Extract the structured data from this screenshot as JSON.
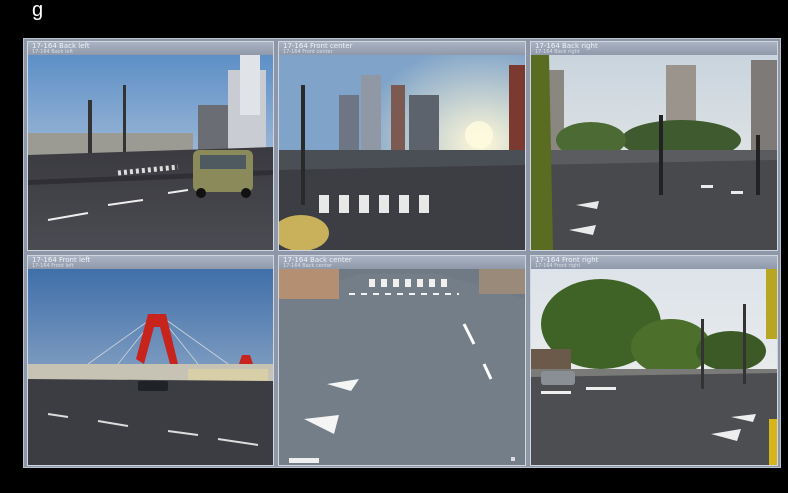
{
  "caption": "g",
  "cameras": [
    {
      "title": "17-164 Back left",
      "subtitle": "17-164 Back left"
    },
    {
      "title": "17-164 Front center",
      "subtitle": "17-164 Front center"
    },
    {
      "title": "17-164 Back right",
      "subtitle": "17-164 Back right"
    },
    {
      "title": "17-164 Front left",
      "subtitle": "17-164 Front left"
    },
    {
      "title": "17-164 Back center",
      "subtitle": "17-164 Back center"
    },
    {
      "title": "17-164 Front right",
      "subtitle": "17-164 Front right"
    }
  ]
}
